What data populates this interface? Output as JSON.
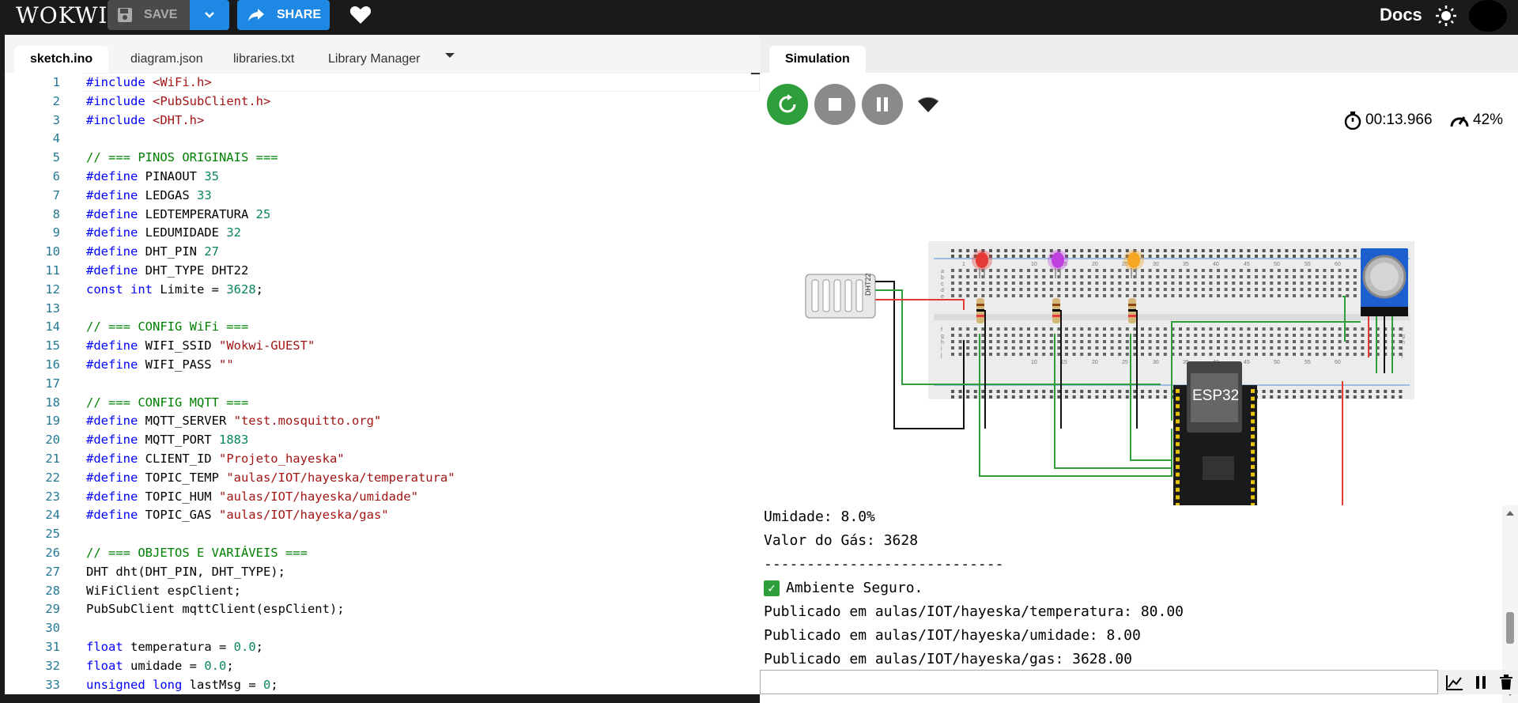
{
  "app": {
    "logo": "WOKWI",
    "save_label": "SAVE",
    "share_label": "SHARE",
    "docs_label": "Docs"
  },
  "editor": {
    "tabs": [
      {
        "label": "sketch.ino",
        "active": true
      },
      {
        "label": "diagram.json",
        "active": false
      },
      {
        "label": "libraries.txt",
        "active": false
      },
      {
        "label": "Library Manager",
        "active": false
      }
    ],
    "lines": [
      {
        "n": "1",
        "t": "#include <WiFi.h>",
        "k": "inc"
      },
      {
        "n": "2",
        "t": "#include <PubSubClient.h>",
        "k": "inc"
      },
      {
        "n": "3",
        "t": "#include <DHT.h>",
        "k": "inc"
      },
      {
        "n": "4",
        "t": "",
        "k": "plain"
      },
      {
        "n": "5",
        "t": "// === PINOS ORIGINAIS ===",
        "k": "comment"
      },
      {
        "n": "6",
        "t": "#define PINAOUT 35",
        "k": "defnum"
      },
      {
        "n": "7",
        "t": "#define LEDGAS 33",
        "k": "defnum"
      },
      {
        "n": "8",
        "t": "#define LEDTEMPERATURA 25",
        "k": "defnum"
      },
      {
        "n": "9",
        "t": "#define LEDUMIDADE 32",
        "k": "defnum"
      },
      {
        "n": "10",
        "t": "#define DHT_PIN 27",
        "k": "defnum"
      },
      {
        "n": "11",
        "t": "#define DHT_TYPE DHT22",
        "k": "defplain"
      },
      {
        "n": "12",
        "t": "const int Limite = 3628;",
        "k": "const"
      },
      {
        "n": "13",
        "t": "",
        "k": "plain"
      },
      {
        "n": "14",
        "t": "// === CONFIG WiFi ===",
        "k": "comment"
      },
      {
        "n": "15",
        "t": "#define WIFI_SSID \"Wokwi-GUEST\"",
        "k": "defstr"
      },
      {
        "n": "16",
        "t": "#define WIFI_PASS \"\"",
        "k": "defstr"
      },
      {
        "n": "17",
        "t": "",
        "k": "plain"
      },
      {
        "n": "18",
        "t": "// === CONFIG MQTT ===",
        "k": "comment"
      },
      {
        "n": "19",
        "t": "#define MQTT_SERVER \"test.mosquitto.org\"",
        "k": "defstr"
      },
      {
        "n": "20",
        "t": "#define MQTT_PORT 1883",
        "k": "defnum"
      },
      {
        "n": "21",
        "t": "#define CLIENT_ID \"Projeto_hayeska\"",
        "k": "defstr"
      },
      {
        "n": "22",
        "t": "#define TOPIC_TEMP \"aulas/IOT/hayeska/temperatura\"",
        "k": "defstr"
      },
      {
        "n": "23",
        "t": "#define TOPIC_HUM \"aulas/IOT/hayeska/umidade\"",
        "k": "defstr"
      },
      {
        "n": "24",
        "t": "#define TOPIC_GAS \"aulas/IOT/hayeska/gas\"",
        "k": "defstr"
      },
      {
        "n": "25",
        "t": "",
        "k": "plain"
      },
      {
        "n": "26",
        "t": "// === OBJETOS E VARIÁVEIS ===",
        "k": "comment"
      },
      {
        "n": "27",
        "t": "DHT dht(DHT_PIN, DHT_TYPE);",
        "k": "plain"
      },
      {
        "n": "28",
        "t": "WiFiClient espClient;",
        "k": "plain"
      },
      {
        "n": "29",
        "t": "PubSubClient mqttClient(espClient);",
        "k": "plain"
      },
      {
        "n": "30",
        "t": "",
        "k": "plain"
      },
      {
        "n": "31",
        "t": "float temperatura = 0.0;",
        "k": "float"
      },
      {
        "n": "32",
        "t": "float umidade = 0.0;",
        "k": "float"
      },
      {
        "n": "33",
        "t": "unsigned long lastMsg = 0;",
        "k": "ulong"
      }
    ]
  },
  "simulation": {
    "tab_label": "Simulation",
    "timer": "00:13.966",
    "speed": "42%",
    "dht_label": "DHT22",
    "esp_label": "ESP32",
    "breadboard_numbers": [
      "1",
      "10",
      "15",
      "20",
      "25",
      "30",
      "35",
      "40",
      "45",
      "50",
      "55",
      "60"
    ],
    "breadboard_rows_top": [
      "a",
      "b",
      "c",
      "d",
      "e"
    ],
    "breadboard_rows_bottom": [
      "f",
      "g",
      "h",
      "i",
      "j"
    ],
    "led_colors": [
      "#e53935",
      "#c040e0",
      "#f5a623"
    ]
  },
  "serial": {
    "lines": [
      "Umidade: 8.0%",
      "Valor do Gás: 3628",
      "----------------------------",
      "Ambiente Seguro.",
      "Publicado em aulas/IOT/hayeska/temperatura: 80.00",
      "Publicado em aulas/IOT/hayeska/umidade: 8.00",
      "Publicado em aulas/IOT/hayeska/gas: 3628.00"
    ]
  }
}
